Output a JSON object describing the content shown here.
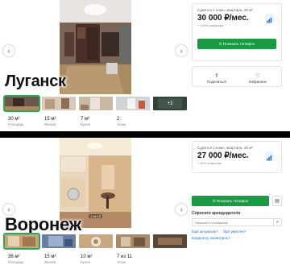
{
  "top": {
    "city": "Луганск",
    "subtitle": "Сдаётся 1-комн. квартира, 30 м²",
    "price": "30 000 ₽/мес.",
    "fee": "+ 100% комиссия",
    "phone_button": "Показать телефон",
    "share_label": "Поделиться",
    "favorite_label": "Избранное",
    "more_photos": "+2",
    "stats": [
      {
        "value": "30 м²",
        "label": "Площадь"
      },
      {
        "value": "15 м²",
        "label": "Жилая"
      },
      {
        "value": "7 м²",
        "label": "Кухня"
      },
      {
        "value": "2",
        "label": "Этаж"
      }
    ]
  },
  "bottom": {
    "city": "Воронеж",
    "subtitle": "Сдаётся 1-комн. квартира, 36 м²",
    "price": "27 000 ₽/мес.",
    "fee": "+ 50% комиссия",
    "phone_button": "Показать телефон",
    "ask_title": "Спросите арендодателя",
    "message_placeholder": "Напишите сообщение",
    "quick_questions": [
      "Ещё актуально?",
      "Торг уместен?",
      "Когда могу посмотреть?"
    ],
    "photo_counter": "1 из 15",
    "stats": [
      {
        "value": "36 м²",
        "label": "Площадь"
      },
      {
        "value": "15 м²",
        "label": "Жилая"
      },
      {
        "value": "10 м²",
        "label": "Кухня"
      },
      {
        "value": "7 из 11",
        "label": "Этаж"
      }
    ]
  },
  "colors": {
    "accent": "#1a9a43",
    "link": "#1a66c2",
    "selected_thumb": "#2eaa52"
  }
}
